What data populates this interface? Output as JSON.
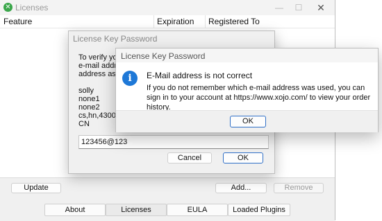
{
  "main_window": {
    "title": "Licenses",
    "columns": [
      "Feature",
      "Expiration",
      "Registered To"
    ],
    "buttons": {
      "update": "Update",
      "add": "Add...",
      "remove": "Remove"
    },
    "tabs": [
      "About",
      "Licenses",
      "EULA",
      "Loaded Plugins"
    ],
    "active_tab": "Licenses"
  },
  "license_key_dialog": {
    "title": "License Key Password",
    "prompt_lines": [
      "To verify your",
      "e-mail addres",
      "address assoc"
    ],
    "info_lines": [
      "solly",
      "none1",
      "none2",
      "cs,hn,430000",
      "CN"
    ],
    "email_value": "123456@123",
    "cancel_label": "Cancel",
    "ok_label": "OK"
  },
  "error_dialog": {
    "title": "License Key Password",
    "heading": "E-Mail address is not correct",
    "body": "If you do not remember which e-mail address was used, you can sign in to your account at https://www.xojo.com/ to view your order history.",
    "ok_label": "OK"
  },
  "icons": {
    "app": "app-logo-icon",
    "info": "info-icon",
    "close": "close-icon",
    "minimize": "minimize-icon",
    "maximize": "maximize-icon"
  },
  "colors": {
    "info_blue": "#1e78d7",
    "app_green": "#3aa64a",
    "default_button_border": "#2f6fc7"
  }
}
